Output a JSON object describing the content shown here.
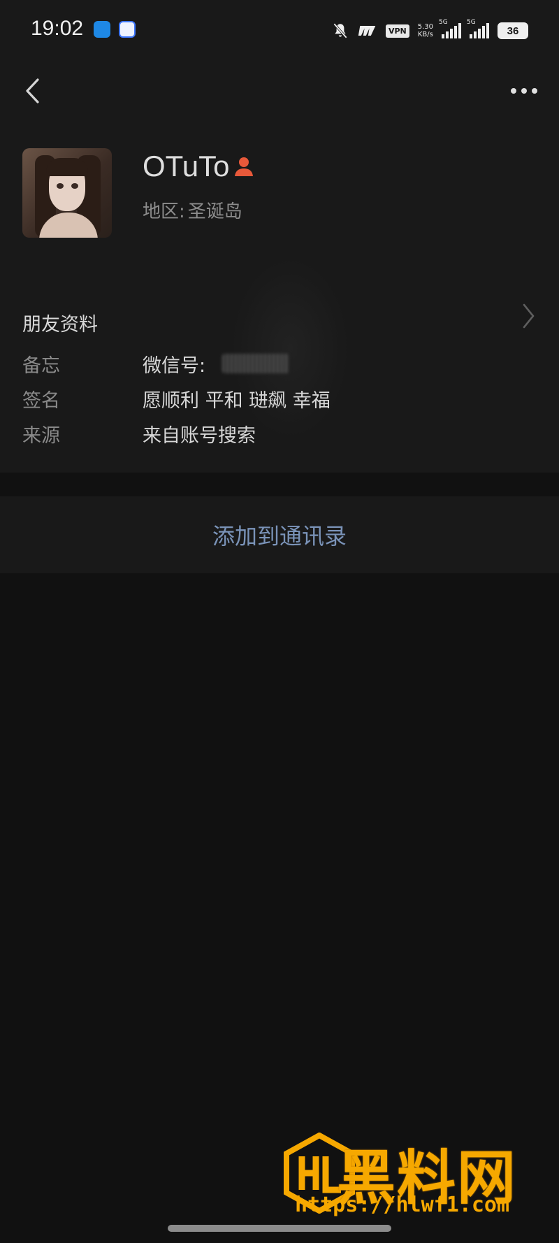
{
  "status_bar": {
    "time": "19:02",
    "vpn": "VPN",
    "speed_value": "5.30",
    "speed_unit": "KB/s",
    "network1": "5G",
    "network2": "5G",
    "battery": "36",
    "icons": [
      "app-icon-1",
      "app-icon-2",
      "mute-bell-icon",
      "wifi-symbol-icon",
      "signal-icon",
      "signal-icon",
      "battery-icon"
    ]
  },
  "header": {
    "back_icon": "chevron-left-icon",
    "more_icon": "more-dots-icon"
  },
  "profile": {
    "nickname": "OTuTo",
    "gender_icon": "person-icon",
    "region_label": "地区:",
    "region_value": "圣诞岛"
  },
  "friend_info": {
    "title": "朋友资料",
    "rows": [
      {
        "label": "备忘",
        "value": "微信号:"
      },
      {
        "label": "签名",
        "value": "愿顺利 平和 琎飙 幸福"
      },
      {
        "label": "来源",
        "value": "来自账号搜索"
      }
    ]
  },
  "actions": {
    "add_to_contacts": "添加到通讯录"
  },
  "watermark": {
    "title": "黑料网",
    "url": "https://hlwf1.com",
    "color": "#f6a800"
  },
  "colors": {
    "background": "#111111",
    "surface": "#191919",
    "link": "#7a93b8",
    "person_icon": "#e8593a"
  }
}
